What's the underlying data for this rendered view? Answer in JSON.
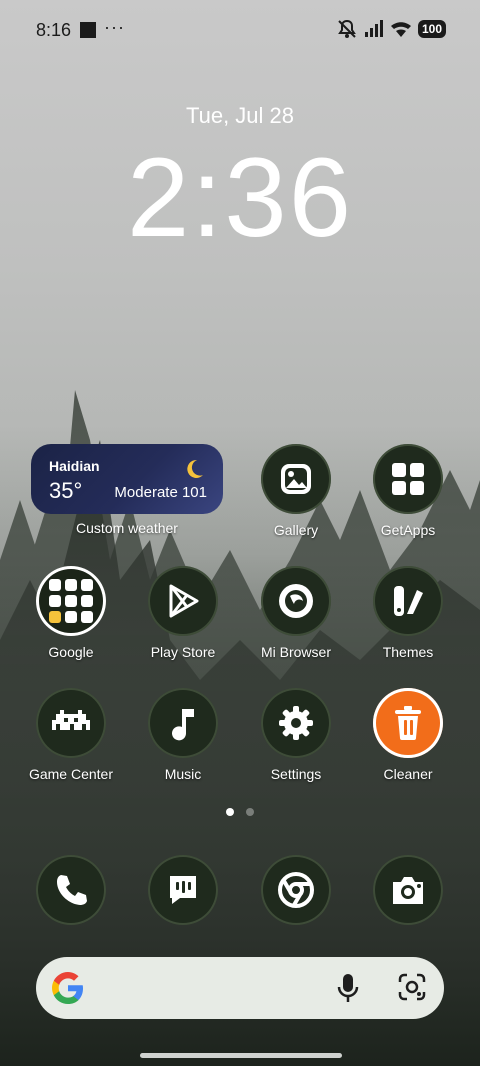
{
  "status": {
    "time": "8:16",
    "more": "···",
    "battery": "100"
  },
  "lockclock": {
    "date": "Tue, Jul 28",
    "time": "2:36"
  },
  "weather": {
    "city": "Haidian",
    "temp": "35°",
    "aqi": "Moderate 101",
    "label": "Custom weather"
  },
  "apps": {
    "gallery": "Gallery",
    "getapps": "GetApps",
    "google": "Google",
    "playstore": "Play Store",
    "mibrowser": "Mi Browser",
    "themes": "Themes",
    "gamecenter": "Game Center",
    "music": "Music",
    "settings": "Settings",
    "cleaner": "Cleaner"
  },
  "icons": {
    "gallery": "gallery-icon",
    "getapps": "getapps-icon",
    "google": "google-folder-icon",
    "playstore": "play-store-icon",
    "mibrowser": "mi-browser-icon",
    "themes": "themes-icon",
    "gamecenter": "game-center-icon",
    "music": "music-icon",
    "settings": "settings-icon",
    "cleaner": "cleaner-icon",
    "phone": "phone-icon",
    "messages": "messages-icon",
    "chrome": "chrome-icon",
    "camera": "camera-icon"
  },
  "colors": {
    "accent": "#f26d1a",
    "icon_bg": "#1f2a1d",
    "search_bg": "#e7ebe5"
  },
  "pager": {
    "pages": 2,
    "current": 1
  }
}
